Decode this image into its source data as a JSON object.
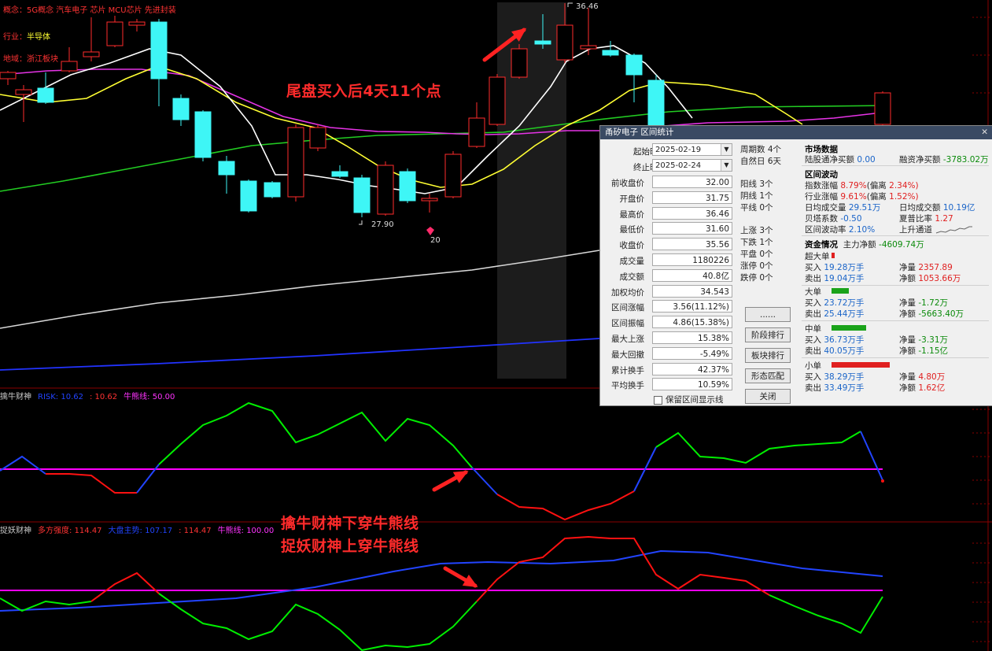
{
  "info": {
    "concept_label": "概念：",
    "concepts": "5G概念 汽车电子 芯片 MCU芯片 先进封装",
    "industry_label": "行业：",
    "industry": "半导体",
    "region_label": "地域：",
    "region": "浙江板块"
  },
  "price_labels": {
    "high": "36.46",
    "low": "27.90",
    "marker": "20"
  },
  "callouts": {
    "top": "尾盘买入后4天11个点",
    "mid1": "擒牛财神下穿牛熊线",
    "mid2": "捉妖财神上穿牛熊线"
  },
  "indicator1": {
    "name": "擒牛财神",
    "risk_label": "RISK: 10.62",
    "value2": ": 10.62",
    "bullbear": "牛熊线: 50.00"
  },
  "indicator2": {
    "name": "捉妖财神",
    "bull_strength": "多方强度: 114.47",
    "big_money": "大盘主势: 107.17",
    "value3": ": 114.47",
    "bullbear": "牛熊线: 100.00"
  },
  "colors": {
    "bull": "#ff2b2b",
    "bear": "#3ef6f6",
    "ma_white": "#ffffff",
    "ma_yellow": "#ffff33",
    "ma_magenta": "#e633e6",
    "ma_green": "#22cc22",
    "ma_blue": "#2233ff",
    "ind_green": "#00ee00",
    "ind_red": "#ff1111",
    "ind_blue": "#2244ff",
    "bullbear": "#ff00ff"
  },
  "dialog": {
    "title": "甬矽电子 区间统计",
    "close": "✕",
    "start_label": "起始时间",
    "start": "2025-02-19",
    "end_label": "终止时间",
    "end": "2025-02-24",
    "fields": [
      {
        "label": "前收盘价",
        "value": "32.00"
      },
      {
        "label": "开盘价",
        "value": "31.75"
      },
      {
        "label": "最高价",
        "value": "36.46"
      },
      {
        "label": "最低价",
        "value": "31.60"
      },
      {
        "label": "收盘价",
        "value": "35.56"
      },
      {
        "label": "成交量",
        "value": "1180226"
      },
      {
        "label": "成交额",
        "value": "40.8亿"
      },
      {
        "label": "加权均价",
        "value": "34.543"
      },
      {
        "label": "区间涨幅",
        "value": "3.56(11.12%)"
      },
      {
        "label": "区间振幅",
        "value": "4.86(15.38%)"
      },
      {
        "label": "最大上涨",
        "value": "15.38%"
      },
      {
        "label": "最大回撤",
        "value": "-5.49%"
      },
      {
        "label": "累计换手",
        "value": "42.37%"
      },
      {
        "label": "平均换手",
        "value": "10.59%"
      }
    ],
    "counts_a": [
      "周期数 4个",
      "自然日 6天"
    ],
    "counts_b": [
      "阳线 3个",
      "阴线 1个",
      "平线 0个"
    ],
    "counts_c": [
      "上涨 3个",
      "下跌 1个",
      "平盘 0个",
      "涨停 0个",
      "跌停 0个"
    ],
    "buttons": [
      "......",
      "阶段排行",
      "板块排行",
      "形态匹配",
      "关闭"
    ],
    "keep_label": "保留区间显示线",
    "market": {
      "head": "市场数据",
      "lgt_label": "陆股通净买额",
      "lgt": "0.00",
      "rz_label": "融资净买额",
      "rz": "-3783.02万"
    },
    "volatility": {
      "head": "区间波动",
      "idx_label": "指数涨幅",
      "idx": "8.79%",
      "idx_dev_label": "(偏离",
      "idx_dev": "2.34%)",
      "ind_label": "行业涨幅",
      "ind": "9.61%",
      "ind_dev_label": "(偏离",
      "ind_dev": "1.52%)",
      "avgvol_label": "日均成交量",
      "avgvol": "29.51万",
      "avgamt_label": "日均成交额",
      "avgamt": "10.19亿",
      "beta_label": "贝塔系数",
      "beta": "-0.50",
      "sharpe_label": "夏普比率",
      "sharpe": "1.27",
      "vol_label": "区间波动率",
      "vol": "2.10%",
      "trend": "上升通道"
    },
    "funds": {
      "head": "资金情况",
      "main_label": "主力净额",
      "main": "-4609.74万",
      "super": {
        "name": "超大单",
        "buy_label": "买入",
        "buy": "19.28万手",
        "sell_label": "卖出",
        "sell": "19.04万手",
        "net_label": "净量",
        "net": "2357.89",
        "neta_label": "净额",
        "neta": "1053.66万"
      },
      "large": {
        "name": "大单",
        "buy_label": "买入",
        "buy": "23.72万手",
        "sell_label": "卖出",
        "sell": "25.44万手",
        "net_label": "净量",
        "net": "-1.72万",
        "neta_label": "净额",
        "neta": "-5663.40万"
      },
      "medium": {
        "name": "中单",
        "buy_label": "买入",
        "buy": "36.73万手",
        "sell_label": "卖出",
        "sell": "40.05万手",
        "net_label": "净量",
        "net": "-3.31万",
        "neta_label": "净额",
        "neta": "-1.15亿"
      },
      "small": {
        "name": "小单",
        "buy_label": "买入",
        "buy": "38.29万手",
        "sell_label": "卖出",
        "sell": "33.49万手",
        "net_label": "净量",
        "net": "4.80万",
        "neta_label": "净额",
        "neta": "1.62亿"
      }
    }
  }
}
